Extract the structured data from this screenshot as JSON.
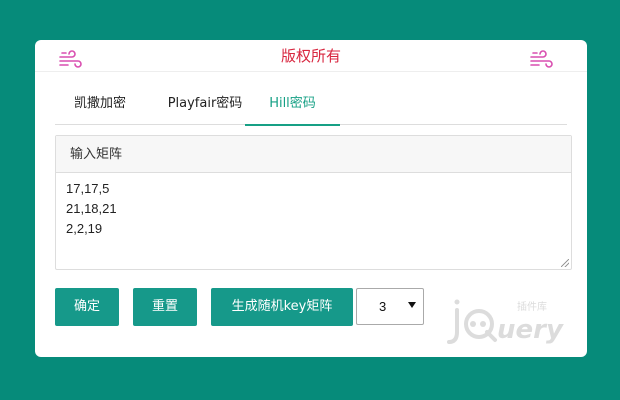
{
  "header": {
    "title": "版权所有",
    "left_icon": "wind-icon",
    "right_icon": "wind-icon"
  },
  "tabs": [
    {
      "label": "凯撒加密",
      "active": false
    },
    {
      "label": "Playfair密码",
      "active": false
    },
    {
      "label": "Hill密码",
      "active": true
    }
  ],
  "panel": {
    "heading": "输入矩阵",
    "matrix_text": "17,17,5\n21,18,21\n2,2,19"
  },
  "buttons": {
    "confirm": "确定",
    "reset": "重置",
    "generate": "生成随机key矩阵"
  },
  "size_select": {
    "value": "3"
  },
  "watermark": {
    "text": "jQuery",
    "subtext": "插件库"
  },
  "colors": {
    "background": "#068b7a",
    "accent": "#16998a",
    "title": "#d8263f",
    "icon": "#d94fb0"
  }
}
